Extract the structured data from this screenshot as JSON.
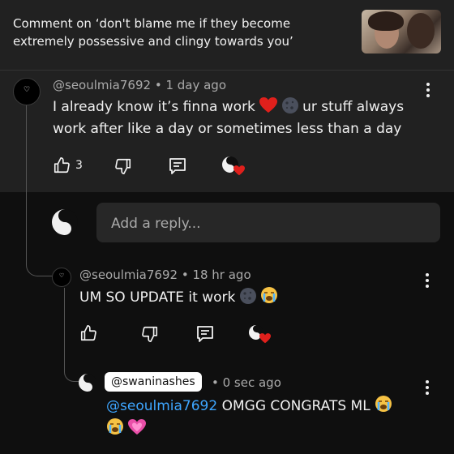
{
  "header": {
    "title": "Comment on ‘don't blame me if they become extremely possessive and clingy towards you’"
  },
  "comment": {
    "author": "@seoulmia7692",
    "time": "• 1 day ago",
    "text_line1": "I already know it’s finna work",
    "text_line1b": "ur stuff always",
    "text_line2": "work after like a day or sometimes less than a day",
    "like_count": "3"
  },
  "reply_input": {
    "placeholder": "Add a reply..."
  },
  "reply1": {
    "author": "@seoulmia7692",
    "time": "• 18 hr ago",
    "text": "UM SO UPDATE it work"
  },
  "reply2": {
    "author_tag": "@swaninashes",
    "time": "• 0 sec ago",
    "mention": "@seoulmia7692",
    "text": "OMGG CONGRATS ML"
  },
  "colors": {
    "background": "#0f0f0f",
    "panel": "#212121",
    "text": "#f1f1f1",
    "muted": "#aaaaaa",
    "link": "#3ea6ff",
    "heart_red": "#e0201c"
  },
  "icons": [
    "thumbs-up-icon",
    "thumbs-down-icon",
    "reply-comment-icon",
    "creator-heart-icon",
    "more-vert-icon",
    "red-heart-emoji",
    "new-moon-face-emoji",
    "loudly-crying-face-emoji",
    "pink-heart-emoji"
  ]
}
